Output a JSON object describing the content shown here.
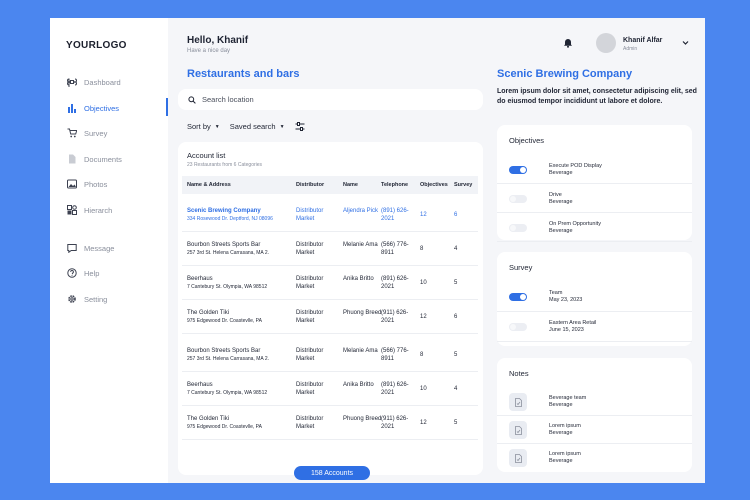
{
  "sidebar": {
    "logo": "YOURLOGO",
    "items": [
      {
        "label": "Dashboard",
        "icon": "command-icon"
      },
      {
        "label": "Objectives",
        "icon": "bar-chart-icon"
      },
      {
        "label": "Survey",
        "icon": "cart-icon"
      },
      {
        "label": "Documents",
        "icon": "document-icon"
      },
      {
        "label": "Photos",
        "icon": "image-icon"
      },
      {
        "label": "Hierarch",
        "icon": "hierarchy-icon"
      }
    ],
    "bottom_items": [
      {
        "label": "Message",
        "icon": "message-icon"
      },
      {
        "label": "Help",
        "icon": "help-icon"
      },
      {
        "label": "Setting",
        "icon": "gear-icon"
      }
    ],
    "active_item": "Objectives"
  },
  "header": {
    "greeting": "Hello, Khanif",
    "subgreeting": "Have a nice day",
    "user_name": "Khanif Alfar",
    "user_role": "Admin"
  },
  "main": {
    "title": "Restaurants and bars",
    "search_placeholder": "Search location",
    "sort_label": "Sort by",
    "saved_search_label": "Saved search",
    "account_list": {
      "title": "Account list",
      "subtitle": "23 Restaurants from 6 Categories",
      "columns": [
        "Name & Address",
        "Distributor",
        "Name",
        "Telephone",
        "Objectives",
        "Survey"
      ],
      "rows": [
        {
          "name": "Scenic Brewing Company",
          "address": "334 Rosewood Dr. Deptford, NJ 08096",
          "distributor": "Distributor Market",
          "contact": "Aljendra Pick",
          "telephone": "(891) 626-2021",
          "objectives": "12",
          "survey": "6",
          "highlight": true
        },
        {
          "name": "Bourbon Streets Sports Bar",
          "address": "257 3rd St. Helena Carrasana, MA 2.",
          "distributor": "Distributor Market",
          "contact": "Melanie Ama",
          "telephone": "(566) 776-8911",
          "objectives": "8",
          "survey": "4",
          "highlight": false
        },
        {
          "name": "Beerhaus",
          "address": "7 Cantebury St. Olympia, WA 98512",
          "distributor": "Distributor Market",
          "contact": "Anika Britto",
          "telephone": "(891) 626-2021",
          "objectives": "10",
          "survey": "5",
          "highlight": false
        },
        {
          "name": "The Golden Tiki",
          "address": "975 Edgewood Dr. Coastevlle, PA",
          "distributor": "Distributor Market",
          "contact": "Phuong Breed",
          "telephone": "(911) 626-2021",
          "objectives": "12",
          "survey": "6",
          "highlight": false
        },
        {
          "name": "Bourbon Streets Sports Bar",
          "address": "257 3rd St. Helena Carrasana, MA 2.",
          "distributor": "Distributor Market",
          "contact": "Melanie Ama",
          "telephone": "(566) 776-8911",
          "objectives": "8",
          "survey": "5",
          "highlight": false
        },
        {
          "name": "Beerhaus",
          "address": "7 Cantebury St. Olympia, WA 98512",
          "distributor": "Distributor Market",
          "contact": "Anika Britto",
          "telephone": "(891) 626-2021",
          "objectives": "10",
          "survey": "4",
          "highlight": false
        },
        {
          "name": "The Golden Tiki",
          "address": "975 Edgewood Dr. Coastevlle, PA",
          "distributor": "Distributor Market",
          "contact": "Phuong Breed",
          "telephone": "(911) 626-2021",
          "objectives": "12",
          "survey": "5",
          "highlight": false
        }
      ],
      "count_button": "158 Accounts"
    }
  },
  "detail": {
    "title": "Scenic Brewing Company",
    "description": "Lorem ipsum dolor sit amet, consectetur adipiscing elit, sed do eiusmod tempor incididunt ut labore et dolore.",
    "objectives": {
      "title": "Objectives",
      "items": [
        {
          "label": "Execute POD Display",
          "sub": "Beverage",
          "on": true
        },
        {
          "label": "Drive",
          "sub": "Beverage",
          "on": false
        },
        {
          "label": "On Prem Opportunity",
          "sub": "Beverage",
          "on": false
        }
      ]
    },
    "survey": {
      "title": "Survey",
      "items": [
        {
          "label": "Team",
          "sub": "May 23, 2023",
          "on": true
        },
        {
          "label": "Eastern Area Retail",
          "sub": "June 15, 2023",
          "on": false
        }
      ]
    },
    "notes": {
      "title": "Notes",
      "items": [
        {
          "label": "Beverage team",
          "sub": "Beverage"
        },
        {
          "label": "Lorem ipsum",
          "sub": "Beverage"
        },
        {
          "label": "Lorem ipsum",
          "sub": "Beverage"
        }
      ]
    }
  },
  "colors": {
    "accent": "#2f6fe4",
    "background": "#4b86ef"
  }
}
